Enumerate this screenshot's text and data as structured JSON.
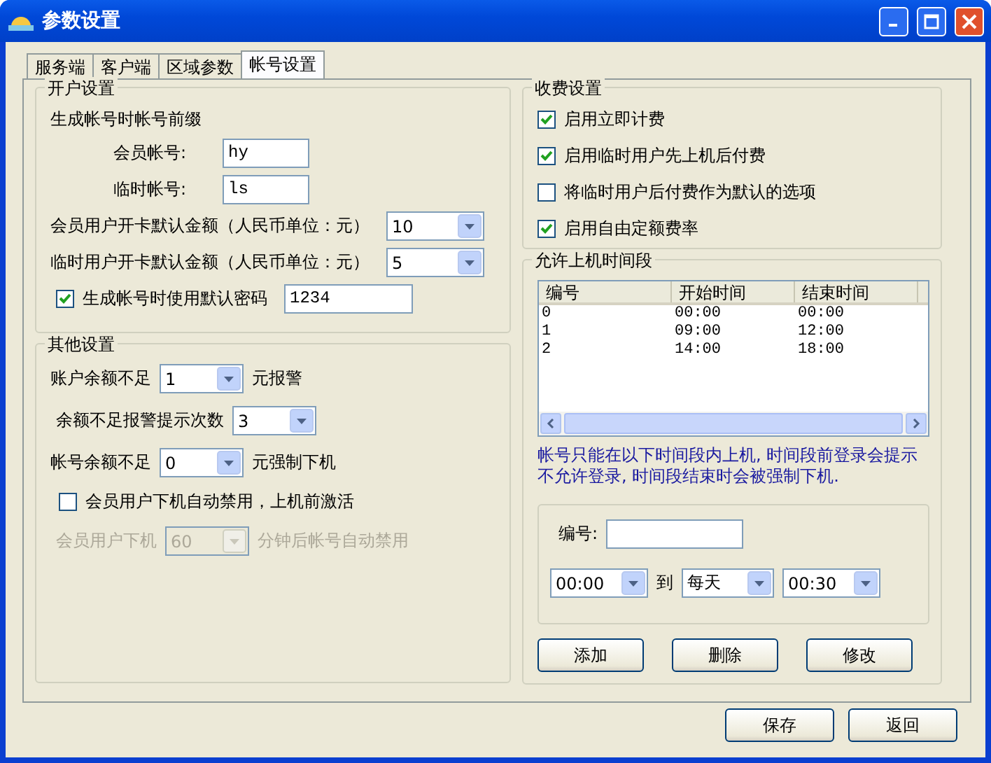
{
  "window": {
    "title": "参数设置"
  },
  "tabs": [
    {
      "label": "服务端",
      "selected": false
    },
    {
      "label": "客户端",
      "selected": false
    },
    {
      "label": "区域参数",
      "selected": false
    },
    {
      "label": "帐号设置",
      "selected": true
    }
  ],
  "account_group": {
    "title": "开户设置",
    "prefix_label": "生成帐号时帐号前缀",
    "prefix_fields": [
      {
        "label": "会员帐号:",
        "value": "hy"
      },
      {
        "label": "临时帐号:",
        "value": "ls"
      }
    ],
    "amounts": [
      {
        "label": "会员用户开卡默认金额（人民币单位：元）",
        "value": "10"
      },
      {
        "label": "临时用户开卡默认金额（人民币单位：元）",
        "value": "5"
      }
    ],
    "password": {
      "label": "生成帐号时使用默认密码",
      "checked": true,
      "value": "1234"
    }
  },
  "other_group": {
    "title": "其他设置",
    "rows": [
      {
        "kind": "combo",
        "label": "账户余额不足",
        "value": "1",
        "suffix": "元报警",
        "disabled": false
      },
      {
        "kind": "combo",
        "label": "余额不足报警提示次数",
        "value": "3",
        "disabled": false
      },
      {
        "kind": "combo",
        "label": "帐号余额不足",
        "value": "0",
        "suffix": "元强制下机",
        "disabled": false
      },
      {
        "kind": "checkbox",
        "label": "会员用户下机自动禁用，上机前激活",
        "checked": false
      },
      {
        "kind": "combo",
        "label": "会员用户下机",
        "value": "60",
        "suffix": "分钟后帐号自动禁用",
        "disabled": true
      }
    ]
  },
  "billing_group": {
    "title": "收费设置",
    "options": [
      {
        "label": "启用立即计费",
        "checked": true
      },
      {
        "label": "启用临时用户先上机后付费",
        "checked": true
      },
      {
        "label": "将临时用户后付费作为默认的选项",
        "checked": false
      },
      {
        "label": "启用自由定额费率",
        "checked": true
      }
    ]
  },
  "time_group": {
    "title": "允许上机时间段",
    "table": {
      "columns": [
        "编号",
        "开始时间",
        "结束时间"
      ],
      "rows": [
        [
          "0",
          "00:00",
          "00:00"
        ],
        [
          "1",
          "09:00",
          "12:00"
        ],
        [
          "2",
          "14:00",
          "18:00"
        ]
      ]
    },
    "note": "帐号只能在以下时间段内上机, 时间段前登录会提示不允许登录, 时间段结束时会被强制下机.",
    "editor": {
      "id_label": "编号:",
      "start": "00:00",
      "to_label": "到",
      "day": "每天",
      "end": "00:30"
    },
    "buttons": [
      "添加",
      "删除",
      "修改"
    ]
  },
  "buttons": [
    "保存",
    "返回"
  ]
}
